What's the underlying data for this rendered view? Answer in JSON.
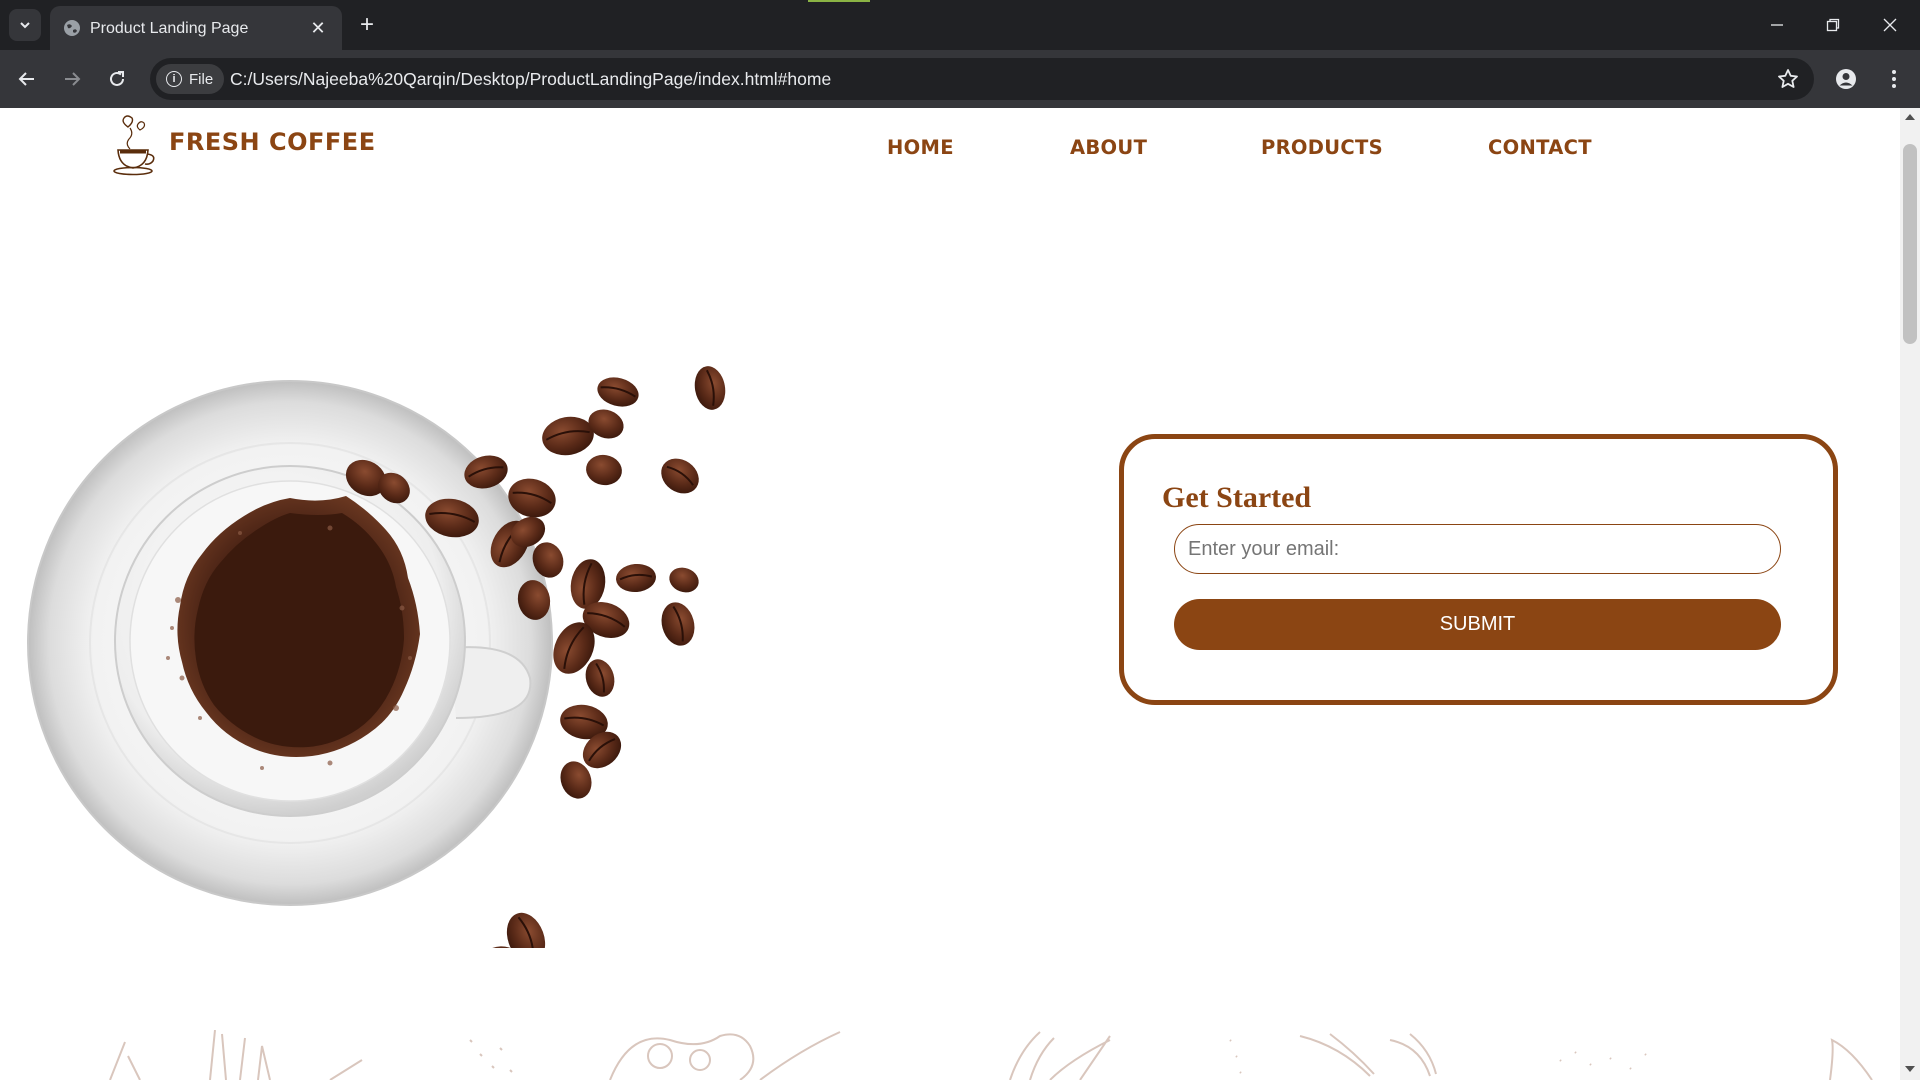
{
  "browser": {
    "tab_title": "Product Landing Page",
    "site_chip": "File",
    "url": "C:/Users/Najeeba%20Qarqin/Desktop/ProductLandingPage/index.html#home"
  },
  "site": {
    "brand": "FRESH COFFEE",
    "nav": [
      "HOME",
      "ABOUT",
      "PRODUCTS",
      "CONTACT"
    ]
  },
  "signup": {
    "heading": "Get Started",
    "email_placeholder": "Enter your email:",
    "submit_label": "SUBMIT"
  },
  "colors": {
    "brand": "#8b4513",
    "chrome_dark": "#202124",
    "chrome_toolbar": "#35363a"
  }
}
